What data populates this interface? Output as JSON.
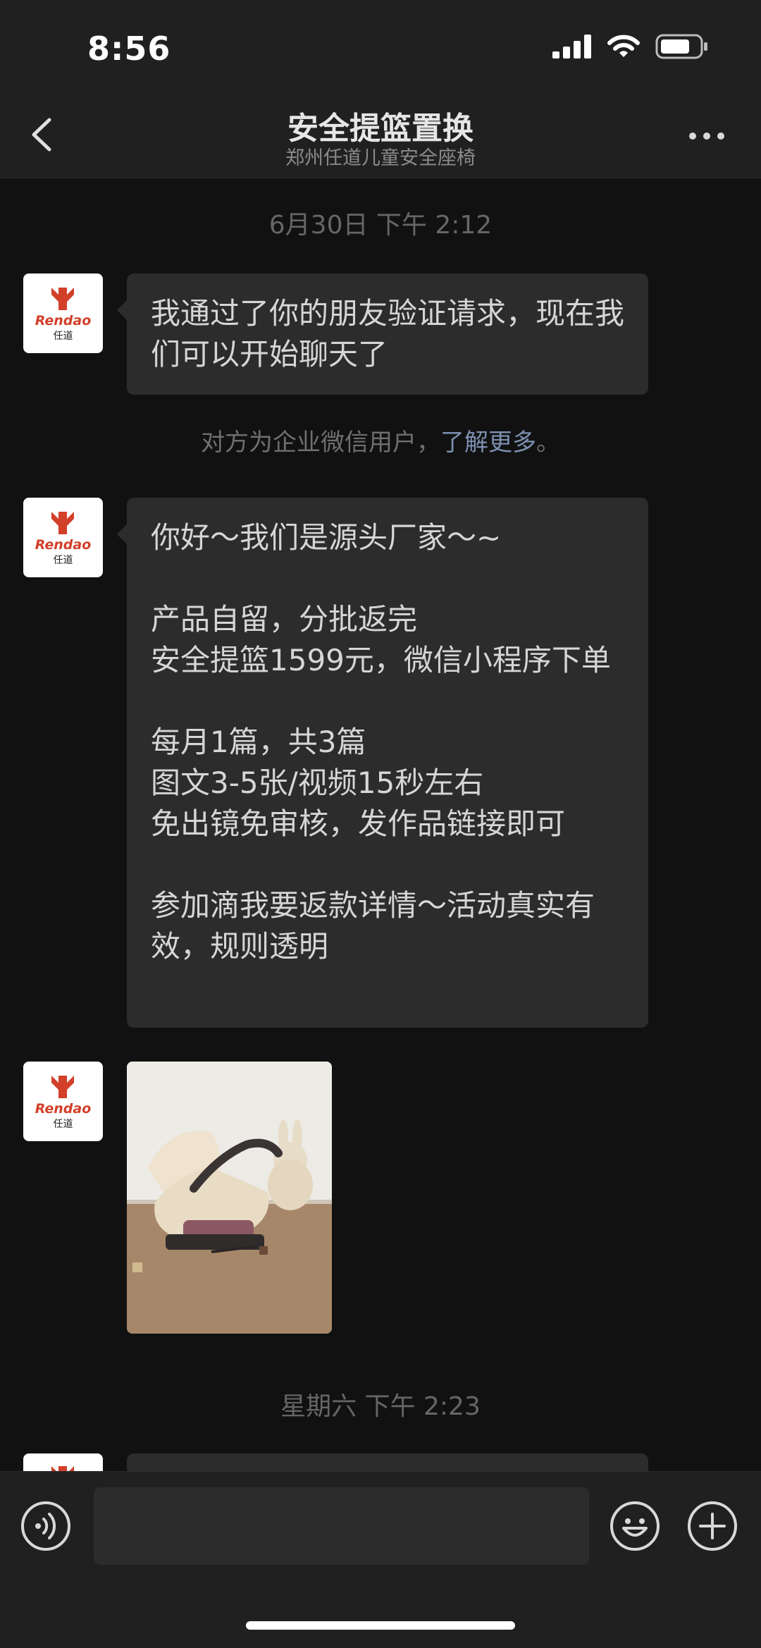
{
  "status_bar": {
    "time": "8:56",
    "icons": [
      "signal-icon",
      "wifi-icon",
      "battery-icon"
    ]
  },
  "header": {
    "title": "安全提篮置换",
    "subtitle": "郑州任道儿童安全座椅"
  },
  "chat": {
    "timestamp_1": "6月30日 下午 2:12",
    "message_1": "我通过了你的朋友验证请求，现在我们可以开始聊天了",
    "system_notice": {
      "text": "对方为企业微信用户，",
      "link": "了解更多",
      "end": "。"
    },
    "message_2": "你好～我们是源头厂家～~\n\n产品自留，分批返完\n安全提篮1599元，微信小程序下单\n\n每月1篇，共3篇\n图文3-5张/视频15秒左右\n免出镜免审核，发作品链接即可\n\n参加滴我要返款详情～活动真实有效，规则透明",
    "timestamp_2": "星期六 下午 2:23"
  },
  "avatar": {
    "logo_text": "Rendao",
    "logo_cn": "任道"
  },
  "colors": {
    "background": "#111111",
    "bar": "#202020",
    "bubble": "#2c2c2c",
    "link": "#7d90b0",
    "logo_red": "#d2402a"
  }
}
